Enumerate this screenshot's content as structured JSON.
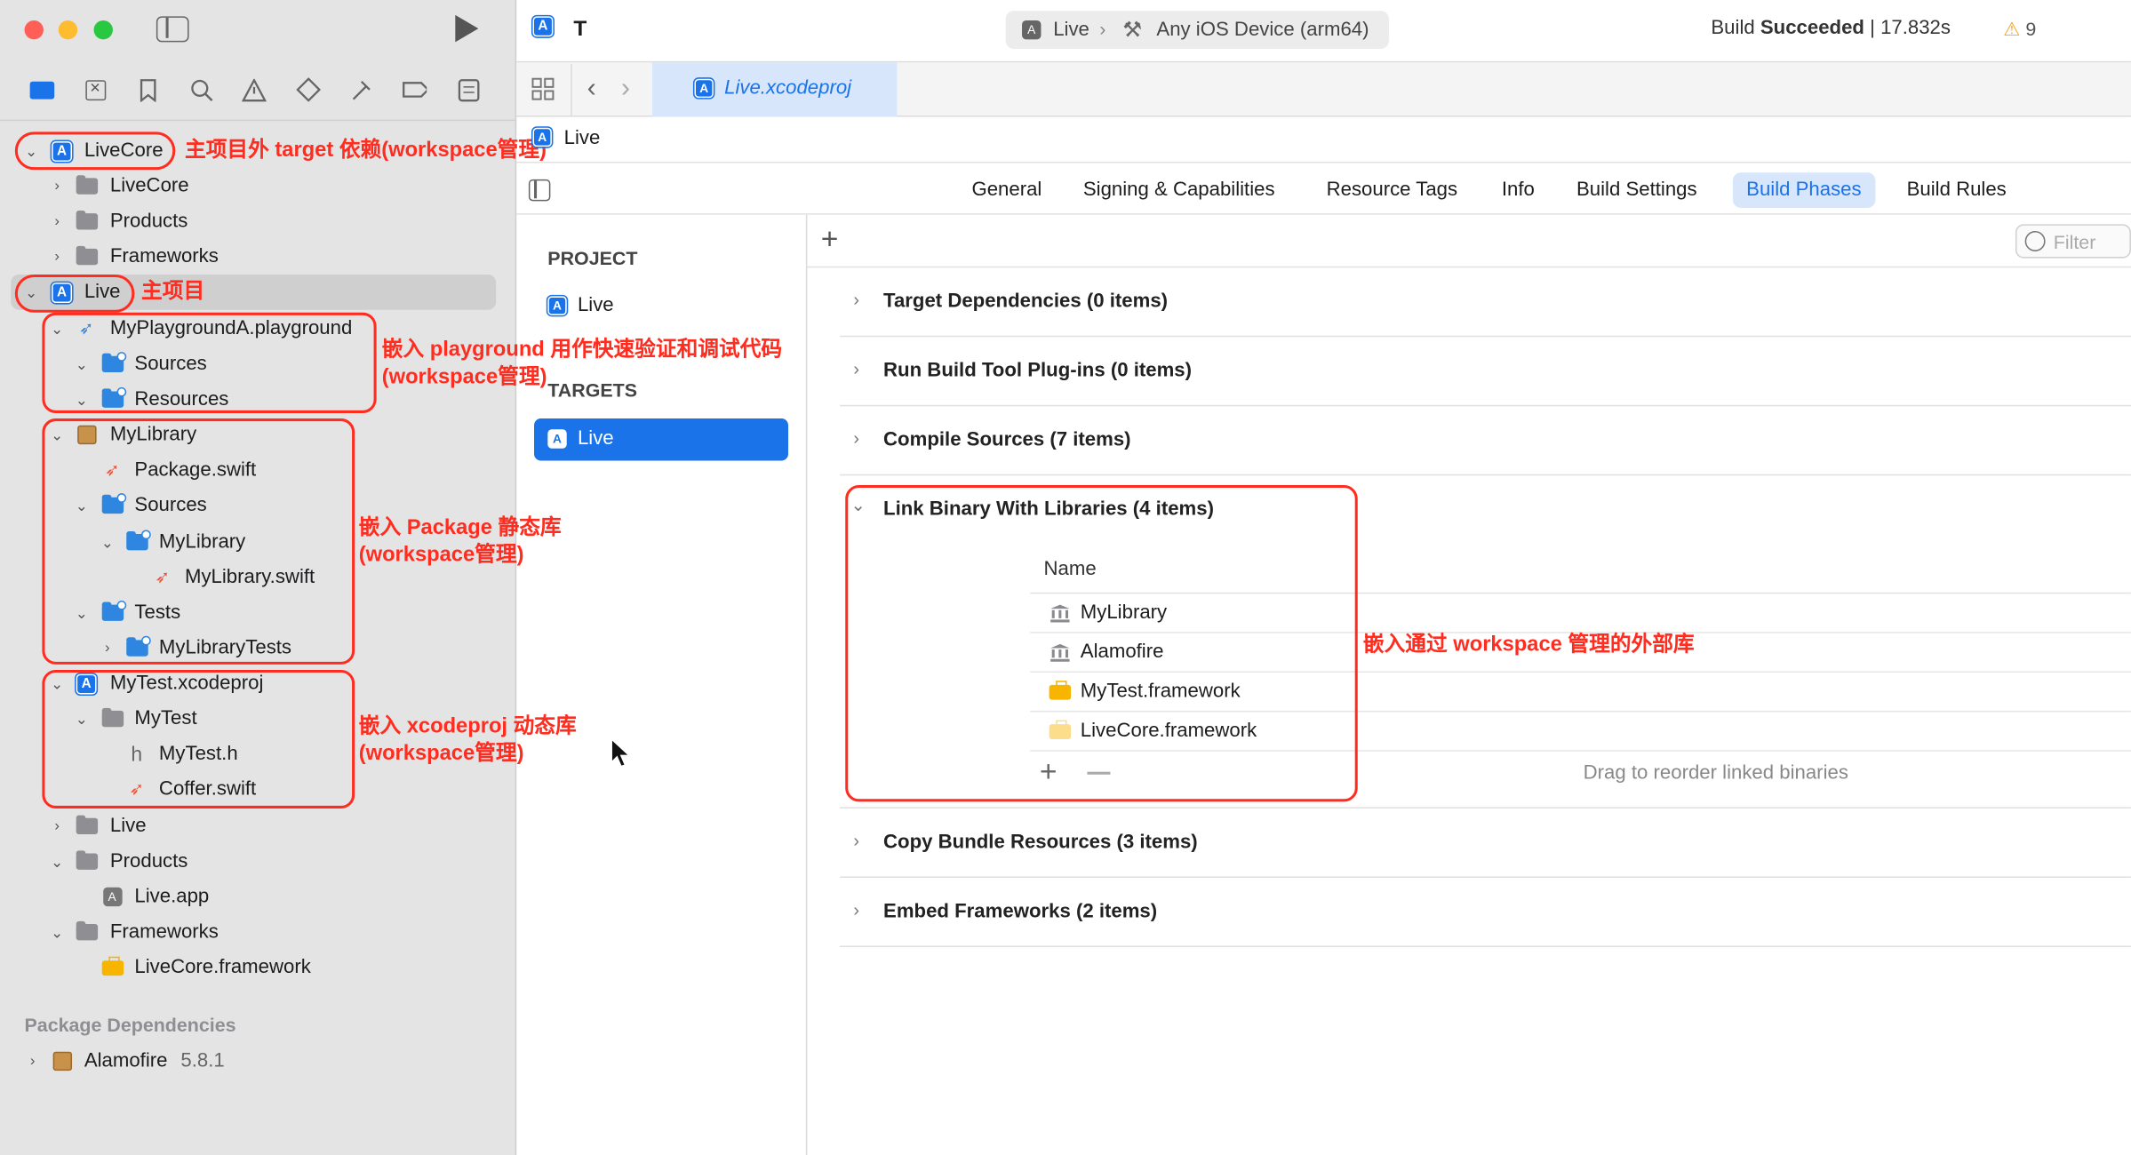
{
  "window": {
    "title": "T",
    "scheme": "Live",
    "destination": "Any iOS Device (arm64)",
    "build_status_prefix": "Build ",
    "build_status_bold": "Succeeded",
    "build_time": "| 17.832s",
    "warning_count": "9"
  },
  "editor": {
    "tab": "Live.xcodeproj",
    "breadcrumb": "Live"
  },
  "navigator": {
    "items": [
      {
        "label": "LiveCore"
      },
      {
        "label": "LiveCore"
      },
      {
        "label": "Products"
      },
      {
        "label": "Frameworks"
      },
      {
        "label": "Live"
      },
      {
        "label": "MyPlaygroundA.playground"
      },
      {
        "label": "Sources"
      },
      {
        "label": "Resources"
      },
      {
        "label": "MyLibrary"
      },
      {
        "label": "Package.swift"
      },
      {
        "label": "Sources"
      },
      {
        "label": "MyLibrary"
      },
      {
        "label": "MyLibrary.swift"
      },
      {
        "label": "Tests"
      },
      {
        "label": "MyLibraryTests"
      },
      {
        "label": "MyTest.xcodeproj"
      },
      {
        "label": "MyTest"
      },
      {
        "label": "MyTest.h"
      },
      {
        "label": "Coffer.swift"
      },
      {
        "label": "Live"
      },
      {
        "label": "Products"
      },
      {
        "label": "Live.app"
      },
      {
        "label": "Frameworks"
      },
      {
        "label": "LiveCore.framework"
      }
    ],
    "package_deps_header": "Package Dependencies",
    "package": {
      "name": "Alamofire",
      "version": "5.8.1"
    }
  },
  "annotations": {
    "livecore": "主项目外 target 依赖(workspace管理)",
    "live": "主项目",
    "playground_1": "嵌入 playground 用作快速验证和调试代码",
    "playground_2": "(workspace管理)",
    "package_1": "嵌入 Package 静态库",
    "package_2": "(workspace管理)",
    "xcodeproj_1": "嵌入 xcodeproj 动态库",
    "xcodeproj_2": "(workspace管理)",
    "libs": "嵌入通过 workspace 管理的外部库"
  },
  "targets_pane": {
    "project_header": "PROJECT",
    "project": "Live",
    "targets_header": "TARGETS",
    "target": "Live"
  },
  "tabs": [
    "General",
    "Signing & Capabilities",
    "Resource Tags",
    "Info",
    "Build Settings",
    "Build Phases",
    "Build Rules"
  ],
  "active_tab": "Build Phases",
  "filter_placeholder": "Filter",
  "phases": [
    "Target Dependencies (0 items)",
    "Run Build Tool Plug-ins (0 items)",
    "Compile Sources (7 items)",
    "Link Binary With Libraries (4 items)",
    "Copy Bundle Resources (3 items)",
    "Embed Frameworks (2 items)"
  ],
  "link_table": {
    "column": "Name",
    "rows": [
      "MyLibrary",
      "Alamofire",
      "MyTest.framework",
      "LiveCore.framework"
    ],
    "hint": "Drag to reorder linked binaries"
  },
  "colors": {
    "accent": "#1a73e8",
    "annotation": "#ff2d20",
    "sidebar_bg": "#e4e4e4"
  }
}
